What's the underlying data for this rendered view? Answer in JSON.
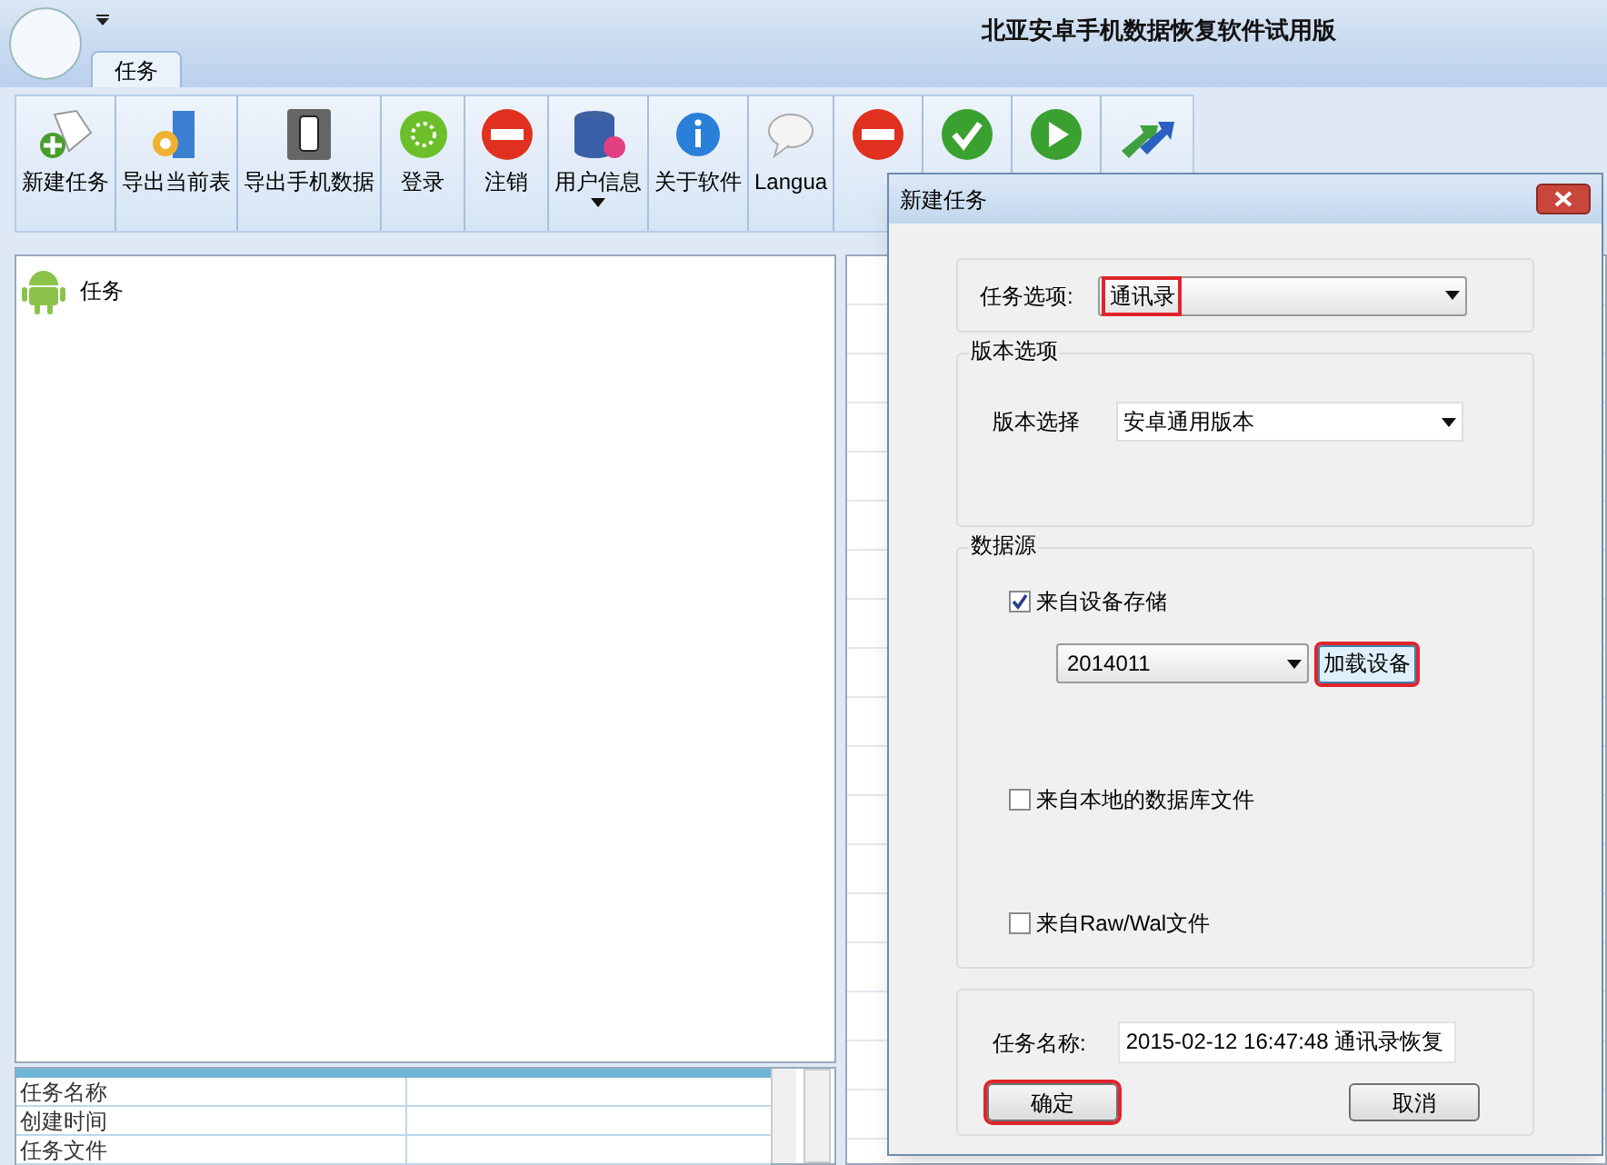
{
  "window": {
    "title": "北亚安卓手机数据恢复软件试用版"
  },
  "tabs": [
    {
      "label": "任务",
      "selected": true
    }
  ],
  "toolbar": [
    {
      "label": "新建任务"
    },
    {
      "label": "导出当前表"
    },
    {
      "label": "导出手机数据"
    },
    {
      "label": "登录"
    },
    {
      "label": "注销"
    },
    {
      "label": "用户信息",
      "dropdown": true
    },
    {
      "label": "关于软件"
    },
    {
      "label": "Langua"
    },
    {
      "kind": "covered"
    },
    {
      "kind": "covered"
    },
    {
      "kind": "covered"
    },
    {
      "kind": "covered"
    }
  ],
  "tree": [
    {
      "label": "任务"
    }
  ],
  "properties": {
    "rows": [
      {
        "name": "任务名称"
      },
      {
        "name": "创建时间"
      },
      {
        "name": "任务文件"
      }
    ]
  },
  "dialog": {
    "title": "新建任务",
    "task_option": {
      "label": "任务选项:",
      "value": "通讯录",
      "highlighted": true
    },
    "version_group": {
      "title": "版本选项",
      "label": "版本选择",
      "value": "安卓通用版本"
    },
    "source_group": {
      "title": "数据源",
      "options": [
        {
          "kind": "device",
          "label": "来自设备存储",
          "checked": true,
          "device": "2014011",
          "load_button": {
            "label": "加载设备",
            "highlighted": true
          }
        },
        {
          "kind": "plain",
          "label": "来自本地的数据库文件",
          "checked": false
        },
        {
          "kind": "plain",
          "label": "来自Raw/Wal文件",
          "checked": false
        }
      ]
    },
    "task_name": {
      "label": "任务名称:",
      "value": "2015-02-12 16:47:48 通讯录恢复"
    },
    "buttons": [
      {
        "label": "确定",
        "highlighted": true
      },
      {
        "label": "取消",
        "highlighted": false
      }
    ]
  }
}
